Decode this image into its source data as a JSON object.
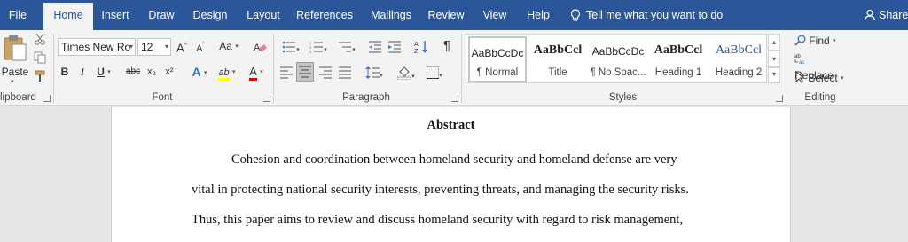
{
  "tabs": [
    {
      "label": "File",
      "active": false
    },
    {
      "label": "Home",
      "active": true
    },
    {
      "label": "Insert",
      "active": false
    },
    {
      "label": "Draw",
      "active": false
    },
    {
      "label": "Design",
      "active": false
    },
    {
      "label": "Layout",
      "active": false
    },
    {
      "label": "References",
      "active": false
    },
    {
      "label": "Mailings",
      "active": false
    },
    {
      "label": "Review",
      "active": false
    },
    {
      "label": "View",
      "active": false
    },
    {
      "label": "Help",
      "active": false
    }
  ],
  "tell_me": "Tell me what you want to do",
  "share": "Share",
  "clipboard": {
    "paste_label": "Paste",
    "group_label": "lipboard"
  },
  "font": {
    "name": "Times New Ro",
    "size": "12",
    "grow": "A",
    "shrink": "A",
    "change_case": "Aa",
    "bold": "B",
    "italic": "I",
    "underline": "U",
    "strike": "abc",
    "subscript": "x₂",
    "superscript": "x²",
    "effects": "A",
    "highlight": "ab",
    "font_color": "A",
    "group_label": "Font"
  },
  "paragraph": {
    "group_label": "Paragraph",
    "pilcrow": "¶"
  },
  "styles": {
    "group_label": "Styles",
    "items": [
      {
        "sample": "AaBbCcDc",
        "name": "¶ Normal",
        "selected": true
      },
      {
        "sample": "AaBbCcl",
        "name": "Title",
        "selected": false
      },
      {
        "sample": "AaBbCcDc",
        "name": "¶ No Spac...",
        "selected": false
      },
      {
        "sample": "AaBbCcl",
        "name": "Heading 1",
        "selected": false
      },
      {
        "sample": "AaBbCcl",
        "name": "Heading 2",
        "selected": false
      }
    ]
  },
  "editing": {
    "find": "Find",
    "replace": "Replace",
    "select": "Select",
    "group_label": "Editing"
  },
  "document": {
    "title": "Abstract",
    "lines": [
      "Cohesion and coordination between homeland security and homeland defense are very",
      "vital in protecting national security interests, preventing threats, and managing the security risks.",
      "Thus, this paper aims to review and discuss homeland security with regard to risk management,"
    ]
  },
  "colors": {
    "title_bar": "#2b579a",
    "ribbon_bg": "#f3f3f3",
    "highlight_yellow": "#ffff00",
    "font_red": "#e00000"
  }
}
